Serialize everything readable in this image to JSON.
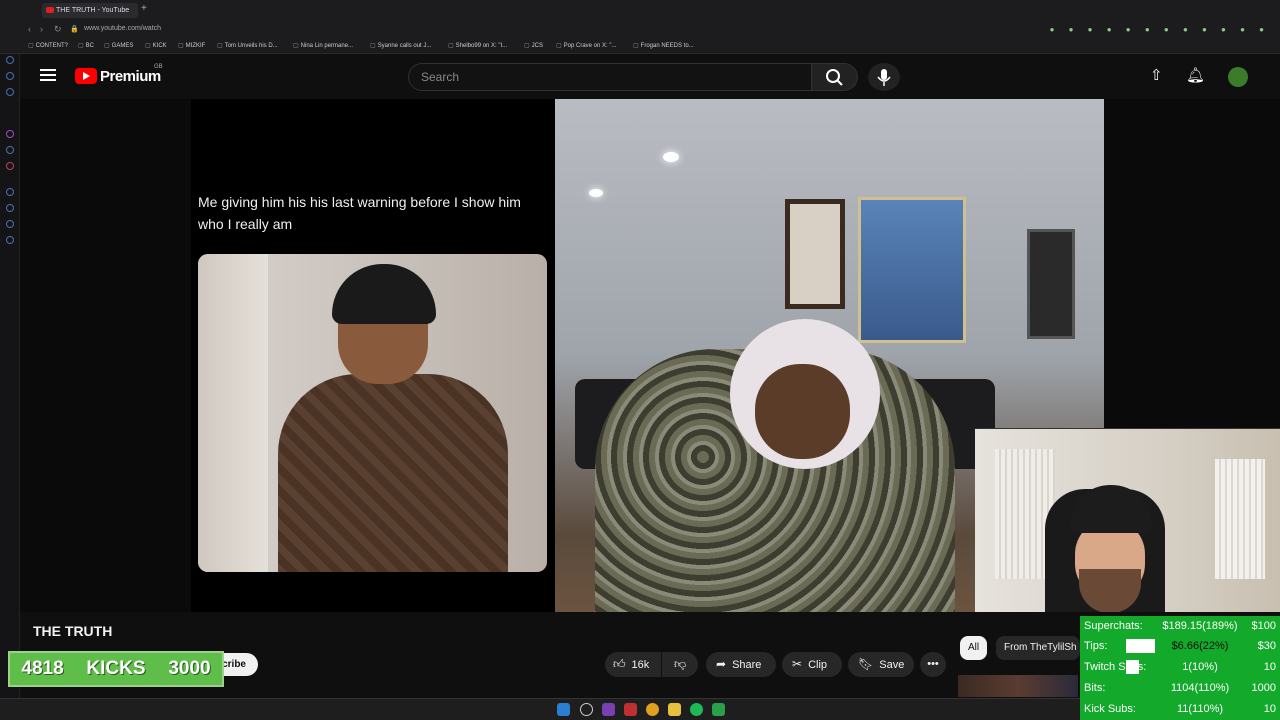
{
  "browser": {
    "tab_title": "THE TRUTH - YouTube",
    "url": "www.youtube.com/watch",
    "bookmarks": [
      "CONTENT?",
      "BC",
      "GAMES",
      "KICK",
      "MIZKIF",
      "Tom Unveils his D...",
      "Nina Lin permane...",
      "Syanne calls out J...",
      "Shelbo99 on X: \"I...",
      "JCS",
      "Pop Crave on X: \"...",
      "Frogan NEEDS to..."
    ]
  },
  "youtube": {
    "brand": "Premium",
    "region": "GB",
    "search_placeholder": "Search"
  },
  "video": {
    "caption": "Me giving him his his last warning before I show him who I really am",
    "title": "THE TRUTH"
  },
  "actions": {
    "subscribe_label": "scribe",
    "like_count": "16k",
    "share_label": "Share",
    "clip_label": "Clip",
    "save_label": "Save"
  },
  "chips": {
    "all": "All",
    "from": "From TheTylilSh"
  },
  "kicks": {
    "current": "4818",
    "label": "KICKS",
    "goal": "3000"
  },
  "goals": [
    {
      "label": "Superchats:",
      "value": "$189.15(189%)",
      "target": "$100",
      "progress": 1.0
    },
    {
      "label": "Tips:",
      "value": "$6.66(22%)",
      "target": "$30",
      "progress": 0.22
    },
    {
      "label": "Twitch Subs:",
      "value": "1(10%)",
      "target": "10",
      "progress": 0.1
    },
    {
      "label": "Bits:",
      "value": "1104(110%)",
      "target": "1000",
      "progress": 1.0
    },
    {
      "label": "Kick Subs:",
      "value": "11(110%)",
      "target": "10",
      "progress": 1.0
    }
  ],
  "colors": {
    "youtube_red": "#ff0000",
    "goals_green": "#13a92a",
    "kicks_green": "#5fbd4a"
  }
}
